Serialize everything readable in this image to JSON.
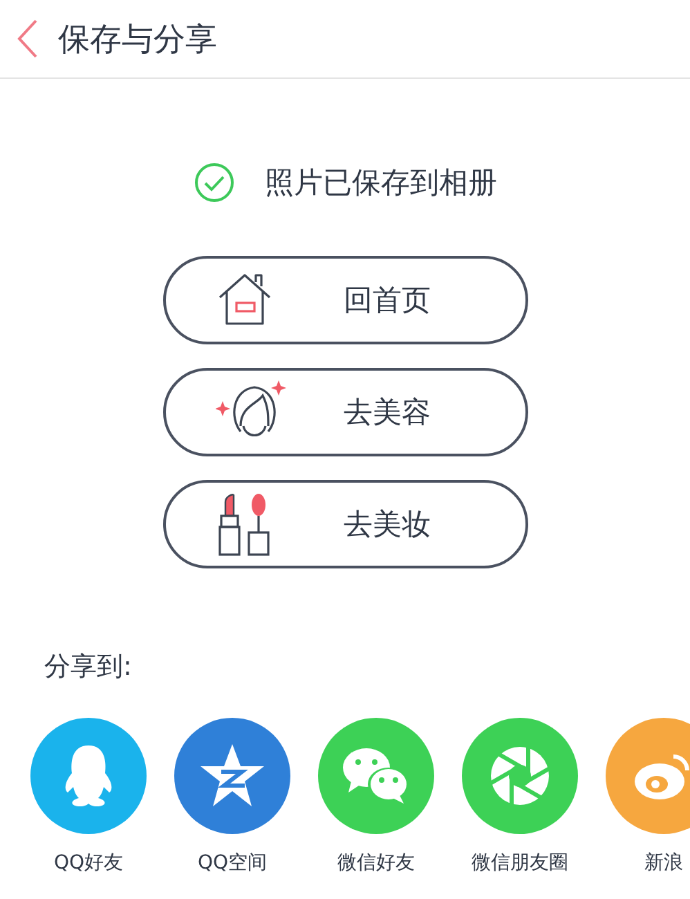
{
  "header": {
    "title": "保存与分享"
  },
  "status": {
    "text": "照片已保存到相册",
    "saved": true
  },
  "actions": [
    {
      "kind": "home",
      "label": "回首页"
    },
    {
      "kind": "beauty",
      "label": "去美容"
    },
    {
      "kind": "makeup",
      "label": "去美妆"
    }
  ],
  "share": {
    "title": "分享到:",
    "targets": [
      {
        "kind": "qq",
        "label": "QQ好友",
        "color": "#1ab3ec"
      },
      {
        "kind": "qzone",
        "label": "QQ空间",
        "color": "#2f80d8"
      },
      {
        "kind": "wechat",
        "label": "微信好友",
        "color": "#3dd156"
      },
      {
        "kind": "moments",
        "label": "微信朋友圈",
        "color": "#3dd156"
      },
      {
        "kind": "weibo",
        "label": "新浪",
        "color": "#f6a73f"
      }
    ]
  }
}
